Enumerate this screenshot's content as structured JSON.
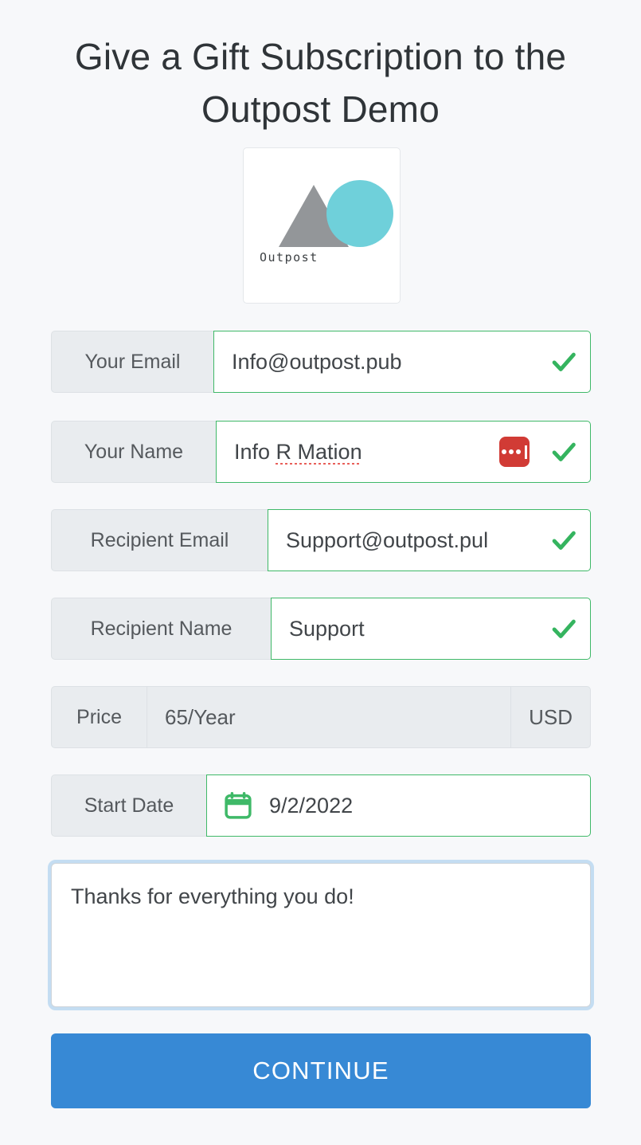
{
  "page": {
    "title": "Give a Gift Subscription to the Outpost Demo",
    "background_color": "#f7f8fa"
  },
  "logo": {
    "name": "Outpost",
    "triangle_color": "#939699",
    "circle_color": "#6fd0da"
  },
  "form": {
    "rows": [
      {
        "label": "Your Email",
        "value": "Info@outpost.pub",
        "valid": true
      },
      {
        "label": "Your Name",
        "value_head": "Info ",
        "value_misspelled": "R Mation",
        "value": "Info R Mation",
        "valid": true
      },
      {
        "label": "Recipient Email",
        "value": "Support@outpost.pul",
        "valid": true
      },
      {
        "label": "Recipient Name",
        "value": "Support",
        "valid": true
      },
      {
        "label": "Price",
        "value": "65/Year",
        "suffix": "USD",
        "disabled": true
      },
      {
        "label": "Start Date",
        "value": "9/2/2022",
        "valid": true
      }
    ],
    "note": {
      "value": "Thanks for everything you do!"
    },
    "submit_label": "CONTINUE"
  },
  "colors": {
    "valid_border": "#3fb968",
    "check_green": "#35b45f",
    "label_gray": "#e9ecef",
    "accent_blue": "#3789d5",
    "focus_ring": "#c4ddf2",
    "lastpass_red": "#d13b35"
  }
}
